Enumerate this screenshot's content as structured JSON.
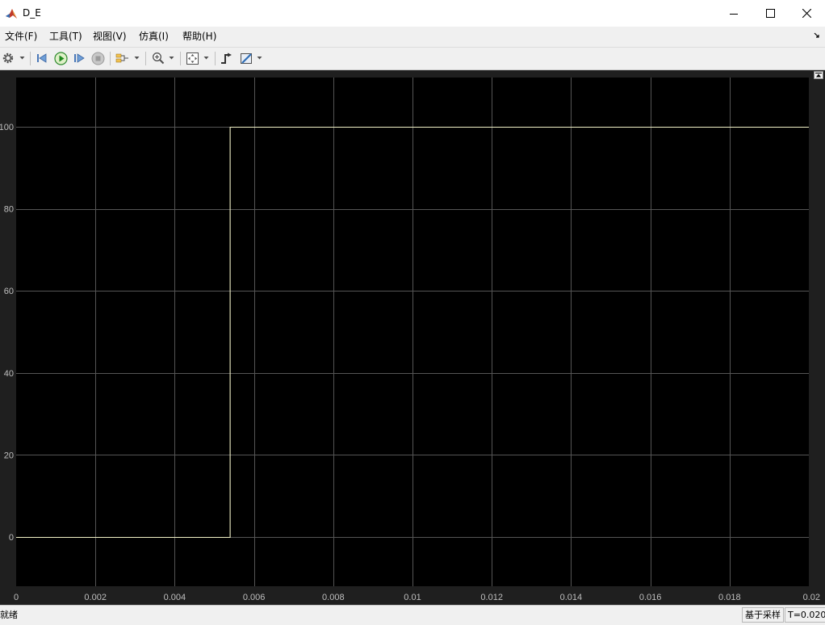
{
  "window": {
    "title": "D_E",
    "minimize_icon": "minimize-icon",
    "maximize_icon": "maximize-icon",
    "close_icon": "close-icon"
  },
  "menu": {
    "items": [
      {
        "label": "文件(F)"
      },
      {
        "label": "工具(T)"
      },
      {
        "label": "视图(V)"
      },
      {
        "label": "仿真(I)"
      },
      {
        "label": "帮助(H)"
      }
    ],
    "corner_icon": "dock-arrow-icon"
  },
  "toolbar": {
    "icons": [
      "settings-gear-icon",
      "step-back-icon",
      "run-icon",
      "step-forward-icon",
      "stop-icon",
      "signal-selector-icon",
      "zoom-in-icon",
      "fit-axes-icon",
      "triggers-icon",
      "measurements-icon"
    ]
  },
  "status": {
    "text": "就绪",
    "mode": "基于采样",
    "time": "T=0.020"
  },
  "colors": {
    "plot_background": "#000000",
    "figure_background": "#1f1f1f",
    "grid": "#555555",
    "line": "#f2f2c8",
    "tick_label": "#bfbfbf"
  },
  "chart_data": {
    "type": "line",
    "title": "",
    "xlabel": "",
    "ylabel": "",
    "xlim": [
      0,
      0.02
    ],
    "ylim": [
      -12,
      112
    ],
    "xticks": [
      0,
      0.002,
      0.004,
      0.006,
      0.008,
      0.01,
      0.012,
      0.014,
      0.016,
      0.018,
      0.02
    ],
    "xtick_labels": [
      "0",
      "0.002",
      "0.004",
      "0.006",
      "0.008",
      "0.01",
      "0.012",
      "0.014",
      "0.016",
      "0.018",
      "0.02"
    ],
    "yticks": [
      0,
      20,
      40,
      60,
      80,
      100
    ],
    "ytick_labels": [
      "0",
      "20",
      "40",
      "60",
      "80",
      "100"
    ],
    "grid": true,
    "series": [
      {
        "x": [
          0,
          0.0054,
          0.0054,
          0.02
        ],
        "y": [
          0,
          0,
          100,
          100
        ]
      }
    ]
  }
}
